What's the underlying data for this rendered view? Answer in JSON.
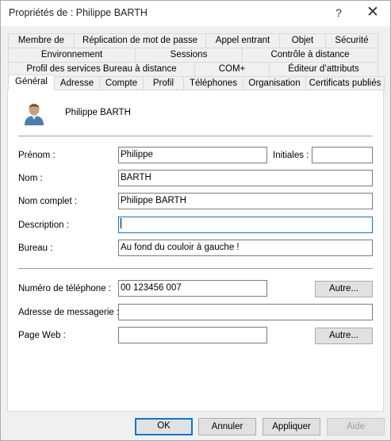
{
  "window": {
    "title": "Propriétés de : Philippe BARTH",
    "help_glyph": "?",
    "close_glyph": "✕"
  },
  "tabs": {
    "row1": [
      "Membre de",
      "Réplication de mot de passe",
      "Appel entrant",
      "Objet",
      "Sécurité"
    ],
    "row2": [
      "Environnement",
      "Sessions",
      "Contrôle à distance"
    ],
    "row3": [
      "Profil des services Bureau à distance",
      "COM+",
      "Éditeur d’attributs"
    ],
    "row4": [
      "Général",
      "Adresse",
      "Compte",
      "Profil",
      "Téléphones",
      "Organisation",
      "Certificats publiés"
    ],
    "active": "Général"
  },
  "general": {
    "user_display_name": "Philippe BARTH",
    "avatar_icon": "user-icon",
    "labels": {
      "first_name": "Prénom :",
      "initials": "Initiales :",
      "last_name": "Nom :",
      "full_name": "Nom complet :",
      "description": "Description :",
      "office": "Bureau :",
      "phone": "Numéro de téléphone :",
      "email": "Adresse de messagerie :",
      "web_page": "Page Web :"
    },
    "values": {
      "first_name": "Philippe",
      "initials": "",
      "last_name": "BARTH",
      "full_name": "Philippe BARTH",
      "description": "",
      "office": "Au fond du couloir à gauche !",
      "phone": "00 123456 007",
      "email": "",
      "web_page": ""
    },
    "other_phone_button": "Autre...",
    "other_web_button": "Autre..."
  },
  "footer": {
    "ok": "OK",
    "cancel": "Annuler",
    "apply": "Appliquer",
    "help": "Aide"
  },
  "colors": {
    "focus_border": "#0078d7",
    "avatar_shirt": "#4a7fb0",
    "avatar_skin": "#c8a07a"
  }
}
